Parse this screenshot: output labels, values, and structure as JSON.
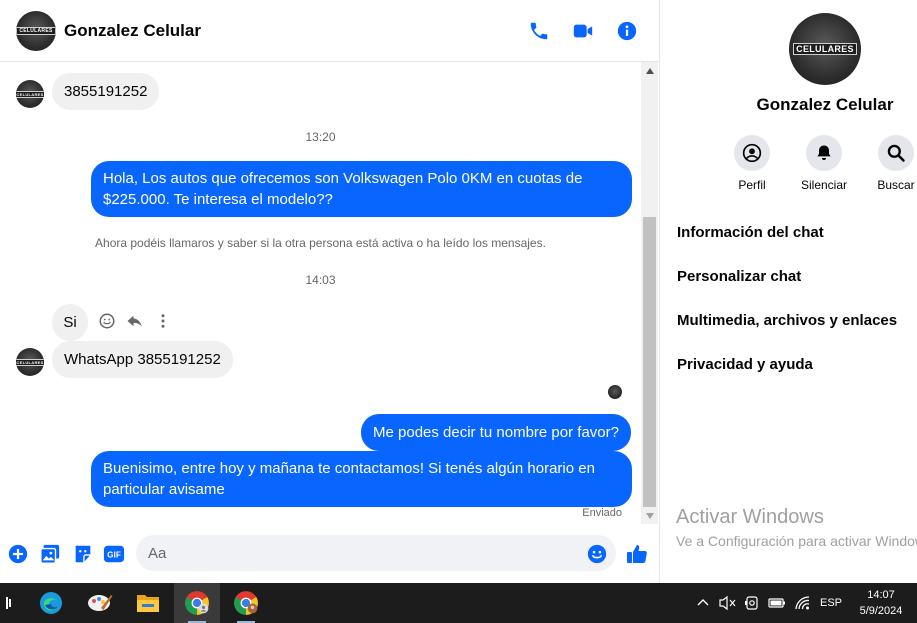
{
  "chat": {
    "contact_name": "Gonzalez Celular",
    "avatar_text": "CELULARES",
    "messages": {
      "m1_text": "3855191252",
      "ts1": "13:20",
      "m2_line1": "Hola, Los autos que ofrecemos son Volkswagen Polo 0KM en cuotas de",
      "m2_line2": "$225.000. Te interesa el modelo??",
      "system_note": "Ahora podéis llamaros y saber si la otra persona está activa o ha leído los mensajes.",
      "ts2": "14:03",
      "m3_text": "Si",
      "m4_text": "WhatsApp 3855191252",
      "m5_text": "Me podes decir tu nombre por favor?",
      "m6_line1": "Buenisimo, entre hoy y mañana te contactamos! Si tenés algún horario en",
      "m6_line2": "particular avisame",
      "status": "Enviado"
    },
    "composer_placeholder": "Aa",
    "colors": {
      "accent": "#0866ff",
      "incoming_bubble": "#f0f0f0"
    }
  },
  "info": {
    "name": "Gonzalez Celular",
    "avatar_text": "CELULARES",
    "actions": [
      {
        "label": "Perfil",
        "icon": "profile-icon"
      },
      {
        "label": "Silenciar",
        "icon": "bell-icon"
      },
      {
        "label": "Buscar",
        "icon": "search-icon"
      }
    ],
    "menu": [
      "Información del chat",
      "Personalizar chat",
      "Multimedia, archivos y enlaces",
      "Privacidad y ayuda"
    ]
  },
  "watermark": {
    "title": "Activar Windows",
    "subtitle": "Ve a Configuración para activar Windows."
  },
  "taskbar": {
    "apps": [
      "edge-icon",
      "paint-icon",
      "file-explorer-icon",
      "chrome-icon",
      "chrome-profile-icon"
    ],
    "language": "ESP",
    "time": "14:07",
    "date": "5/9/2024"
  }
}
